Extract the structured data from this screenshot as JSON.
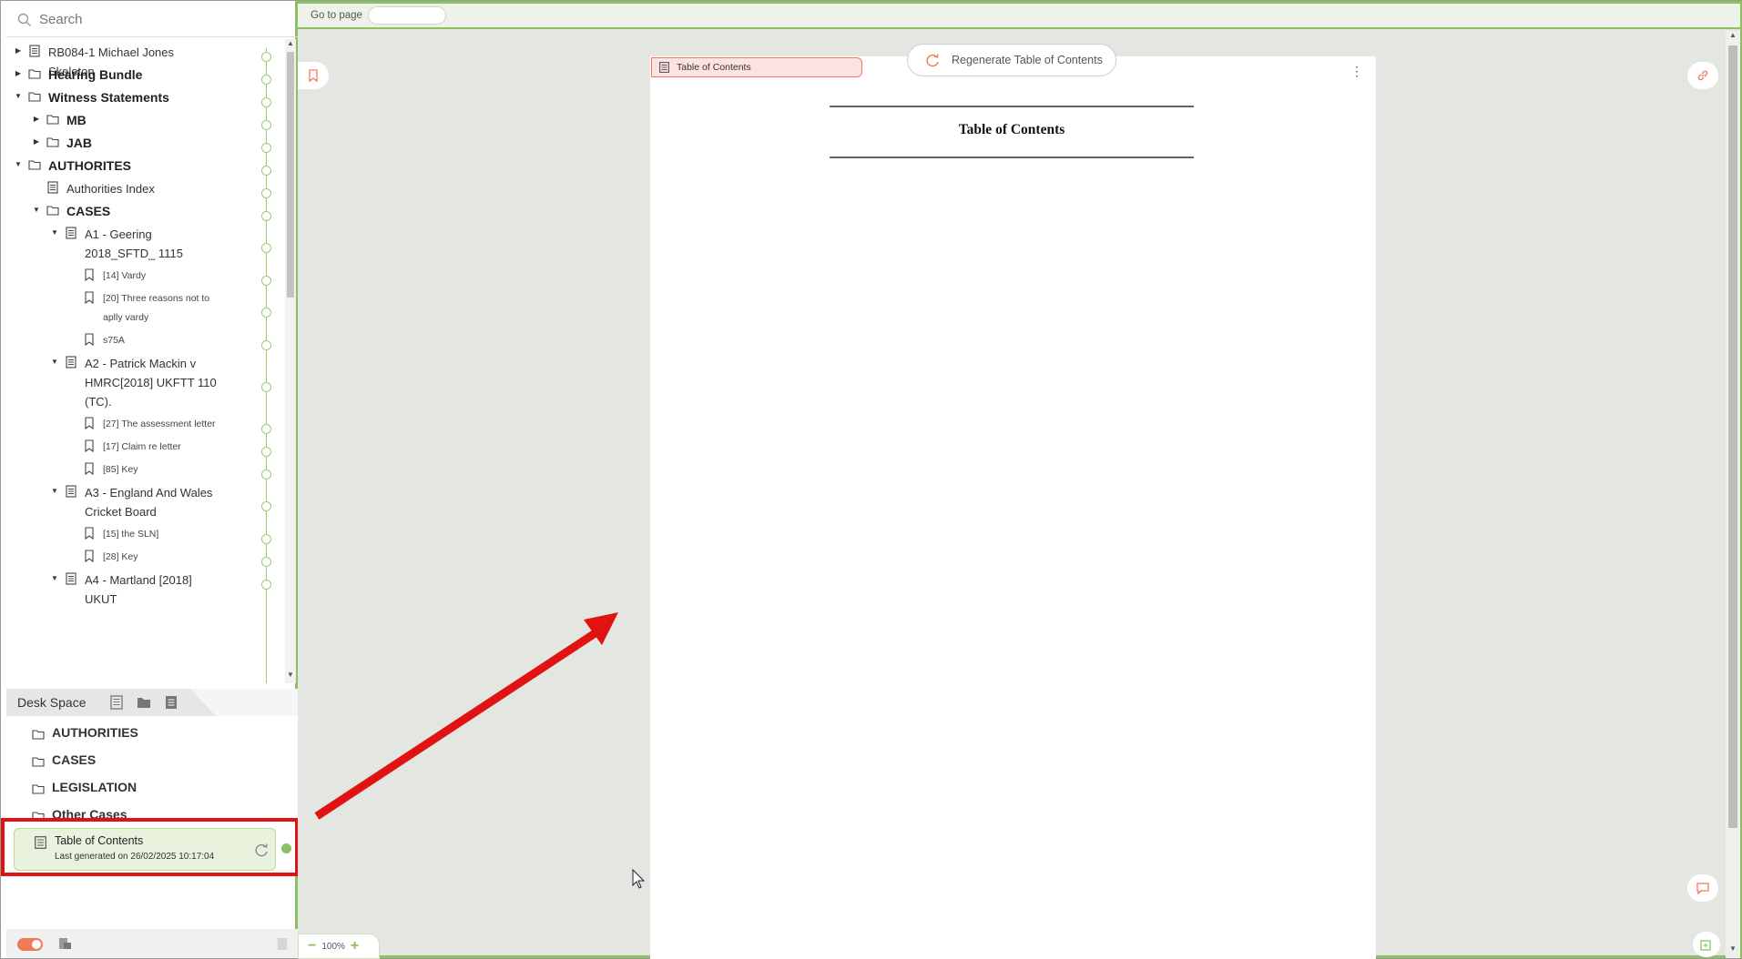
{
  "search": {
    "placeholder": "Search"
  },
  "tree": [
    {
      "label": "RB084-1 Michael Jones Skeleton",
      "kind": "doc",
      "level": 0,
      "arrow": "right",
      "bold": false,
      "small": false
    },
    {
      "label": "Hearing Bundle",
      "kind": "folder",
      "level": 0,
      "arrow": "right",
      "bold": true,
      "small": false
    },
    {
      "label": "Witness Statements",
      "kind": "folder",
      "level": 0,
      "arrow": "down",
      "bold": true,
      "small": false
    },
    {
      "label": "MB",
      "kind": "folder",
      "level": 1,
      "arrow": "right",
      "bold": true,
      "small": false
    },
    {
      "label": "JAB",
      "kind": "folder",
      "level": 1,
      "arrow": "right",
      "bold": true,
      "small": false
    },
    {
      "label": "AUTHORITES",
      "kind": "folder",
      "level": 0,
      "arrow": "down",
      "bold": true,
      "small": false
    },
    {
      "label": "Authorities Index",
      "kind": "doc",
      "level": 1,
      "arrow": "",
      "bold": false,
      "small": false
    },
    {
      "label": "CASES",
      "kind": "folder",
      "level": 1,
      "arrow": "down",
      "bold": true,
      "small": false
    },
    {
      "label": "A1 - Geering 2018_SFTD_ 1115",
      "kind": "doc",
      "level": 2,
      "arrow": "down",
      "bold": false,
      "small": false
    },
    {
      "label": "[14] Vardy",
      "kind": "bookmark",
      "level": 3,
      "arrow": "",
      "bold": false,
      "small": true
    },
    {
      "label": "[20] Three reasons not to aplly vardy",
      "kind": "bookmark",
      "level": 3,
      "arrow": "",
      "bold": false,
      "small": true
    },
    {
      "label": "s75A",
      "kind": "bookmark",
      "level": 3,
      "arrow": "",
      "bold": false,
      "small": true
    },
    {
      "label": "A2 - Patrick Mackin v HMRC[2018] UKFTT 110 (TC).",
      "kind": "doc",
      "level": 2,
      "arrow": "down",
      "bold": false,
      "small": false
    },
    {
      "label": "[27] The assessment letter",
      "kind": "bookmark",
      "level": 3,
      "arrow": "",
      "bold": false,
      "small": true
    },
    {
      "label": "[17] Claim re letter",
      "kind": "bookmark",
      "level": 3,
      "arrow": "",
      "bold": false,
      "small": true
    },
    {
      "label": "[85] Key",
      "kind": "bookmark",
      "level": 3,
      "arrow": "",
      "bold": false,
      "small": true
    },
    {
      "label": "A3 - England And Wales Cricket Board",
      "kind": "doc",
      "level": 2,
      "arrow": "down",
      "bold": false,
      "small": false
    },
    {
      "label": "[15] the SLN]",
      "kind": "bookmark",
      "level": 3,
      "arrow": "",
      "bold": false,
      "small": true
    },
    {
      "label": "[28] Key",
      "kind": "bookmark",
      "level": 3,
      "arrow": "",
      "bold": false,
      "small": true
    },
    {
      "label": "A4 - Martland [2018] UKUT",
      "kind": "doc",
      "level": 2,
      "arrow": "down",
      "bold": false,
      "small": false
    }
  ],
  "desk_space": {
    "tab_label": "Desk Space",
    "items": [
      "AUTHORITIES",
      "CASES",
      "LEGISLATION",
      "Other Cases"
    ]
  },
  "toc_card": {
    "name": "Table of Contents",
    "status": "Last generated on 26/02/2025 10:17:04"
  },
  "viewer": {
    "goto_label": "Go to page",
    "goto_value": "",
    "tab_chip": "Table of Contents",
    "regen_label": "Regenerate Table of Contents",
    "page_title": "Table of Contents",
    "zoom": "100%"
  },
  "colors": {
    "accent_green": "#8cc063",
    "accent_orange": "#f07a55",
    "highlight_red": "#e11212"
  }
}
